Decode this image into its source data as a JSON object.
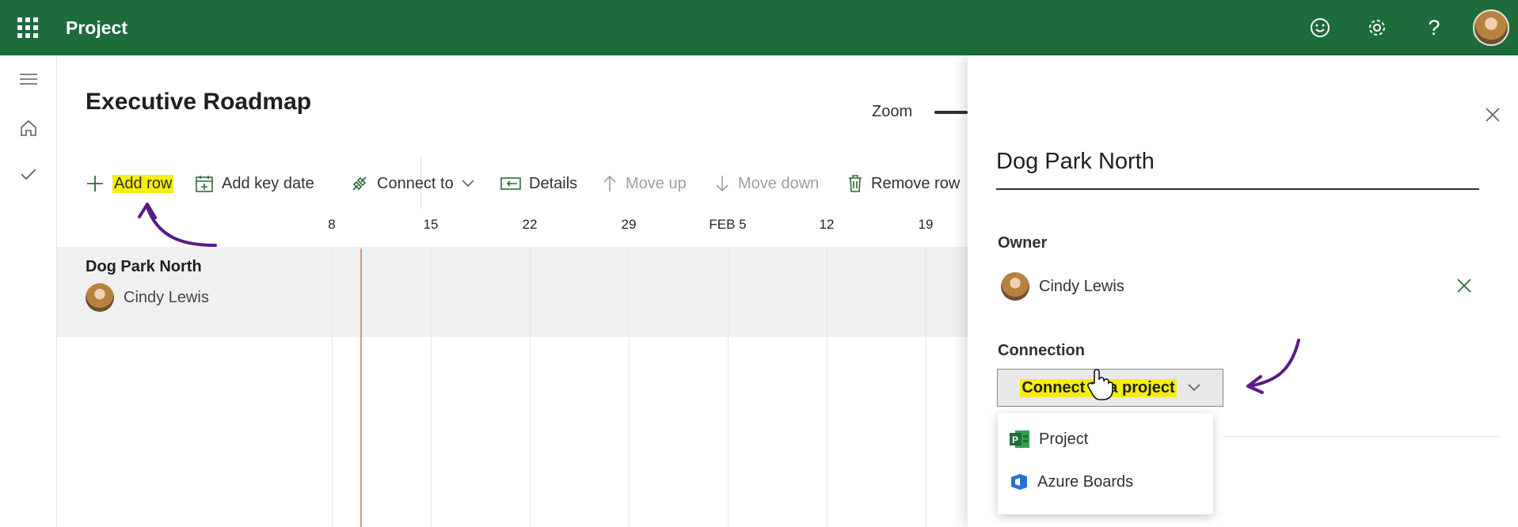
{
  "app": {
    "name": "Project"
  },
  "header_icons": [
    "waffle-icon",
    "smiley-icon",
    "gear-icon",
    "help-icon",
    "user-avatar"
  ],
  "help_glyph": "?",
  "rail": [
    "menu-icon",
    "home-icon",
    "check-icon"
  ],
  "page": {
    "title": "Executive Roadmap",
    "zoom_label": "Zoom"
  },
  "toolbar": {
    "add_row": "Add row",
    "add_key_date": "Add key date",
    "connect_to": "Connect to",
    "details": "Details",
    "move_up": "Move up",
    "move_down": "Move down",
    "remove_row": "Remove row"
  },
  "timeline": {
    "dates": [
      "8",
      "15",
      "22",
      "29",
      "FEB 5",
      "12",
      "19"
    ]
  },
  "row": {
    "title": "Dog Park North",
    "owner": "Cindy Lewis"
  },
  "panel": {
    "title": "Dog Park North",
    "owner_label": "Owner",
    "owner_name": "Cindy Lewis",
    "connection_label": "Connection",
    "connect_button": "Connect to a project",
    "options": [
      {
        "label": "Project",
        "icon": "project-icon"
      },
      {
        "label": "Azure Boards",
        "icon": "azure-boards-icon"
      }
    ]
  },
  "colors": {
    "header": "#1e6b3c",
    "highlight": "#f6ee12",
    "annotation": "#5b1a86",
    "today_line": "#d89a6a"
  }
}
